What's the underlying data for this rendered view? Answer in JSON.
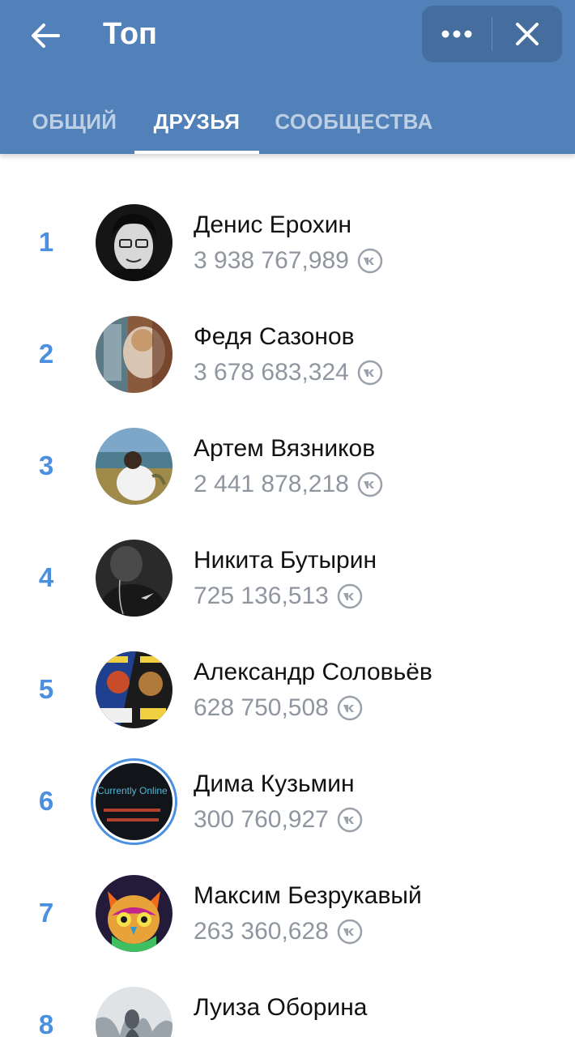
{
  "header": {
    "title": "Топ",
    "back_icon": "arrow-left-icon",
    "more_icon": "more-horizontal-icon",
    "close_icon": "close-icon",
    "background_color": "#5181b8"
  },
  "tabs": [
    {
      "label": "ОБЩИЙ",
      "active": false
    },
    {
      "label": "ДРУЗЬЯ",
      "active": true
    },
    {
      "label": "СООБЩЕСТВА",
      "active": false
    }
  ],
  "leaderboard": {
    "score_icon": "vk-coin-icon",
    "rank_color": "#4a8fe0",
    "rows": [
      {
        "rank": "1",
        "name": "Денис Ерохин",
        "score": "3 938 767,989"
      },
      {
        "rank": "2",
        "name": "Федя Сазонов",
        "score": "3 678 683,324"
      },
      {
        "rank": "3",
        "name": "Артем Вязников",
        "score": "2 441 878,218"
      },
      {
        "rank": "4",
        "name": "Никита Бутырин",
        "score": "725 136,513"
      },
      {
        "rank": "5",
        "name": "Александр Соловьёв",
        "score": "628 750,508"
      },
      {
        "rank": "6",
        "name": "Дима Кузьмин",
        "score": "300 760,927",
        "avatar_text": "Currently Online"
      },
      {
        "rank": "7",
        "name": "Максим Безрукавый",
        "score": "263 360,628"
      },
      {
        "rank": "8",
        "name": "Луиза Оборина",
        "score": ""
      }
    ]
  }
}
